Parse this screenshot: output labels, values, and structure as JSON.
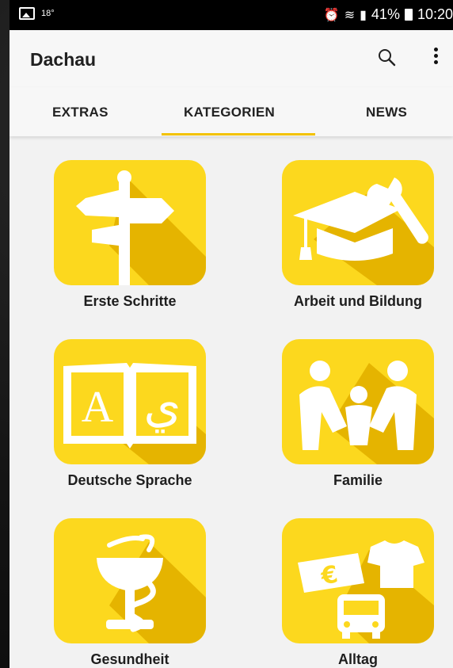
{
  "status_bar": {
    "temperature": "18°",
    "battery": "41%",
    "time": "10:20"
  },
  "toolbar": {
    "title": "Dachau"
  },
  "tabs": [
    {
      "label": "EXTRAS",
      "active": false
    },
    {
      "label": "KATEGORIEN",
      "active": true
    },
    {
      "label": "NEWS",
      "active": false
    }
  ],
  "categories": [
    {
      "label": "Erste Schritte",
      "icon": "signpost-icon"
    },
    {
      "label": "Arbeit und Bildung",
      "icon": "graduation-cap-wrench-icon"
    },
    {
      "label": "Deutsche Sprache",
      "icon": "open-book-icon"
    },
    {
      "label": "Familie",
      "icon": "family-icon"
    },
    {
      "label": "Gesundheit",
      "icon": "bowl-of-hygieia-icon"
    },
    {
      "label": "Alltag",
      "icon": "money-shirt-bus-icon"
    }
  ],
  "colors": {
    "tile": "#fcd81e",
    "tile_shadow": "#e5b400",
    "accent": "#f2c200"
  }
}
